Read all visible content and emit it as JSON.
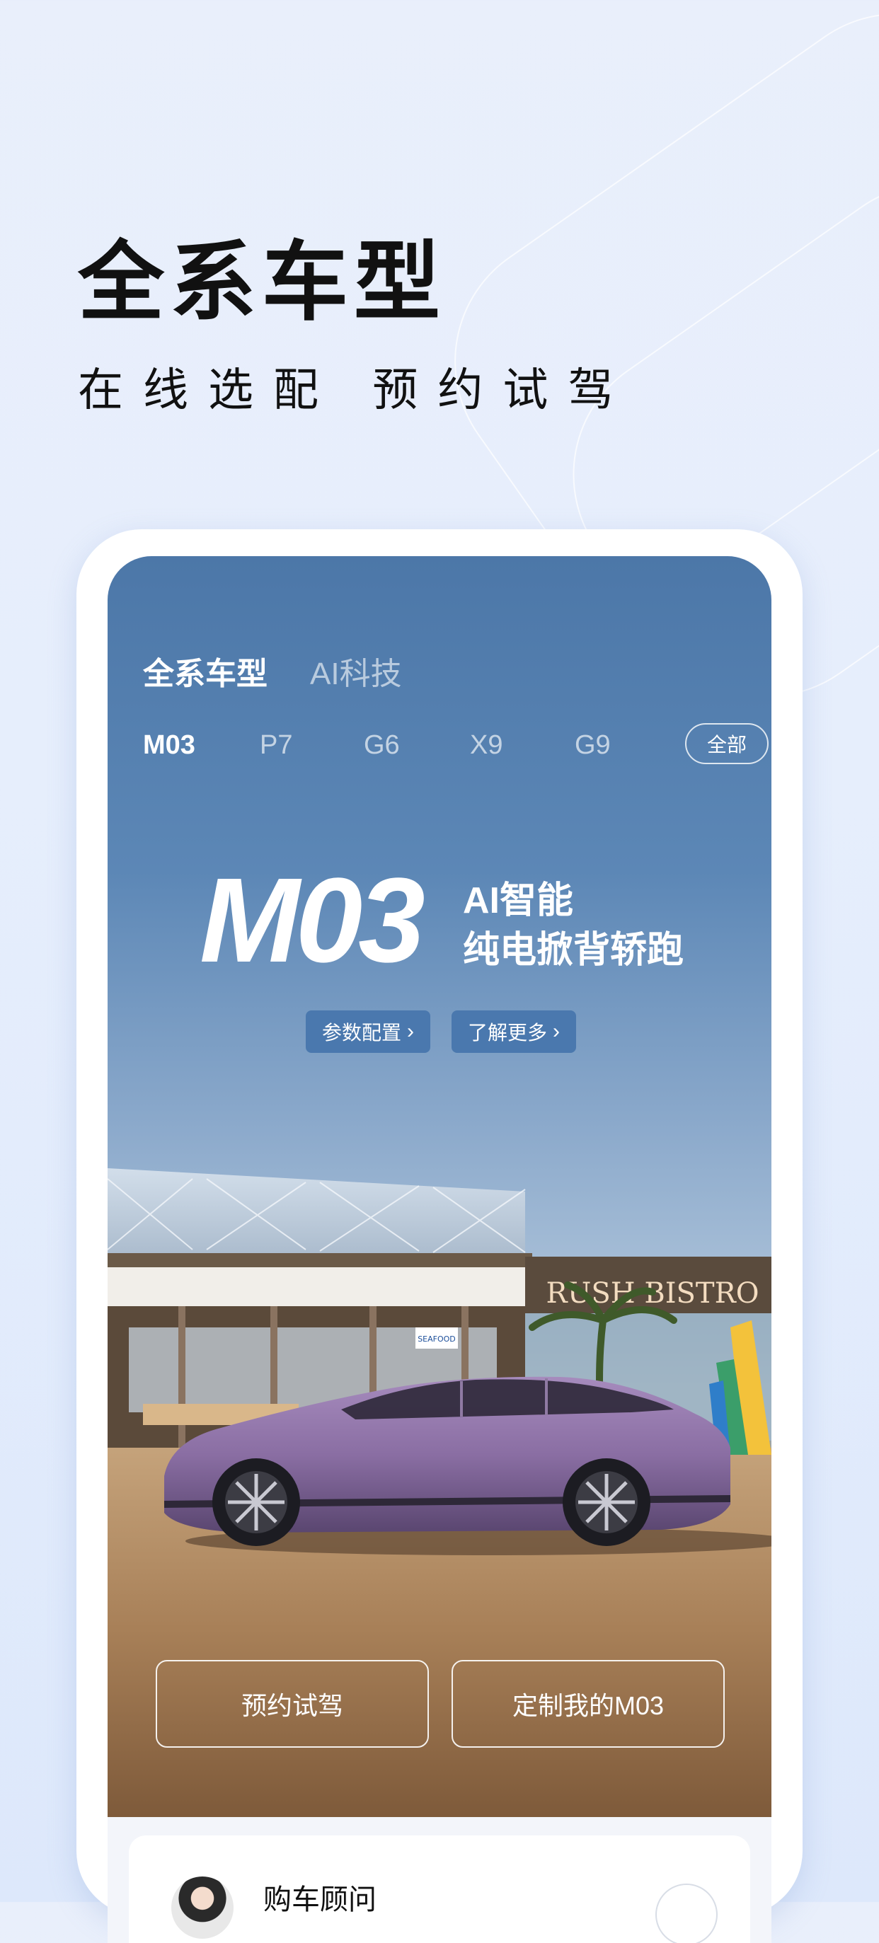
{
  "promo": {
    "title": "全系车型",
    "subtitle": "在线选配 预约试驾"
  },
  "app": {
    "tabs": [
      {
        "label": "全系车型",
        "active": true
      },
      {
        "label": "AI科技",
        "active": false
      }
    ],
    "models": [
      {
        "label": "M03",
        "active": true
      },
      {
        "label": "P7",
        "active": false
      },
      {
        "label": "G6",
        "active": false
      },
      {
        "label": "X9",
        "active": false
      },
      {
        "label": "G9",
        "active": false
      }
    ],
    "all_label": "全部",
    "hero": {
      "model_name": "M03",
      "tagline_line1": "AI智能",
      "tagline_line2": "纯电掀背轿跑",
      "params_label": "参数配置",
      "learn_more_label": "了解更多",
      "scene_signs": {
        "bistro": "RUSH BISTRO",
        "seafood": "SEAFOOD"
      }
    },
    "cta": {
      "test_drive": "预约试驾",
      "customize": "定制我的M03"
    },
    "advisor": {
      "label": "购车顾问"
    }
  },
  "colors": {
    "accent_button": "#4a78ae",
    "car_body": "#8a6ea3",
    "sky_top": "#4c77a8"
  }
}
